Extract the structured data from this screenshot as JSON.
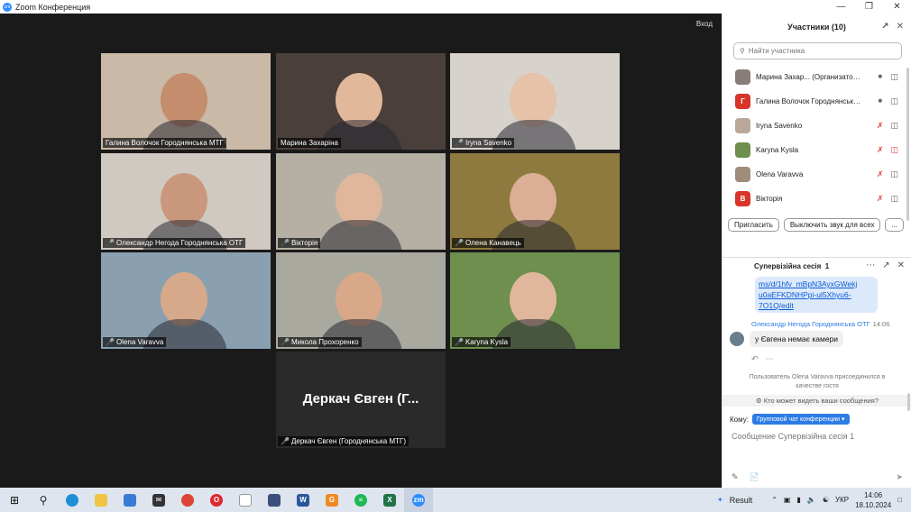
{
  "window": {
    "title": "Zoom Конференция",
    "login_label": "Вход"
  },
  "tiles": [
    {
      "name": "Галина Волочок Городнянська МТГ",
      "muted": false,
      "highlighted": false,
      "bg": "#c9b9a6",
      "skin": "#c48d6e"
    },
    {
      "name": "Марина Захаріна",
      "muted": false,
      "highlighted": true,
      "bg": "#4a3f3a",
      "skin": "#e2b89b"
    },
    {
      "name": "Iryna Savenko",
      "muted": true,
      "highlighted": false,
      "bg": "#d8d2cc",
      "skin": "#e6c2a8"
    },
    {
      "name": "Олександр Негода Городнянська ОТГ",
      "muted": true,
      "highlighted": false,
      "bg": "#d0c9c2",
      "skin": "#c9987c"
    },
    {
      "name": "Вікторія",
      "muted": true,
      "highlighted": false,
      "bg": "#b6b0a4",
      "skin": "#e0b79c"
    },
    {
      "name": "Олена Канавець",
      "muted": true,
      "highlighted": false,
      "bg": "#8e7a3e",
      "skin": "#dcae95"
    },
    {
      "name": "Olena Varavva",
      "muted": true,
      "highlighted": false,
      "bg": "#8aa0b0",
      "skin": "#d7a98b"
    },
    {
      "name": "Микола Прохоренко",
      "muted": true,
      "highlighted": false,
      "bg": "#a9a9a0",
      "skin": "#d9a889"
    },
    {
      "name": "Karyna Kysla",
      "muted": true,
      "highlighted": false,
      "bg": "#6f8f4e",
      "skin": "#e0b79c"
    },
    {
      "name": "Деркач Євген (Городнянська МТГ)",
      "muted": true,
      "highlighted": false,
      "bg": "#242424",
      "skin": "",
      "placeholder": "Деркач Євген (Г..."
    }
  ],
  "participants_panel": {
    "title": "Участники (10)",
    "search_placeholder": "Найти участника",
    "participants": [
      {
        "name": "Марина Захар... (Организатор, я)",
        "avatar": "",
        "avatar_color": "#8a7d77",
        "mic_muted": false,
        "video_off": false
      },
      {
        "name": "Галина Волочок Городнянська ...",
        "avatar": "Г",
        "avatar_color": "#d9352a",
        "mic_muted": false,
        "video_off": false
      },
      {
        "name": "Iryna Savenko",
        "avatar": "",
        "avatar_color": "#b9a89a",
        "mic_muted": true,
        "video_off": false
      },
      {
        "name": "Karyna Kysla",
        "avatar": "",
        "avatar_color": "#6f8f4e",
        "mic_muted": true,
        "video_off": true
      },
      {
        "name": "Olena Varavva",
        "avatar": "",
        "avatar_color": "#a08c7a",
        "mic_muted": true,
        "video_off": false
      },
      {
        "name": "Вікторія",
        "avatar": "В",
        "avatar_color": "#d9352a",
        "mic_muted": true,
        "video_off": false
      }
    ],
    "invite_label": "Пригласить",
    "mute_all_label": "Выключить звук для всех",
    "more_label": "..."
  },
  "chat": {
    "title": "Супервізійна сесія",
    "title_count": "1",
    "link_text": "ms/d/1hfv_mBpN3AyxGWekj u0aEFKDNHPpi-ul5Xhyu6-7O1Q/edit",
    "sender": "Олександр Негода Городнянська ОТГ",
    "time": "14:06",
    "message": "у Євгена немає камери",
    "system_note": "Пользователь Olena Varavva присоединился в качестве гостя",
    "who_can_see": "Кто может видеть ваши сообщения?",
    "to_label": "Кому:",
    "to_value": "Групповой чат конференции",
    "compose_placeholder": "Сообщение Супервізійна сесія  1"
  },
  "taskbar": {
    "result_label": "Result",
    "lang": "УКР",
    "time": "14:06",
    "date": "18.10.2024"
  }
}
